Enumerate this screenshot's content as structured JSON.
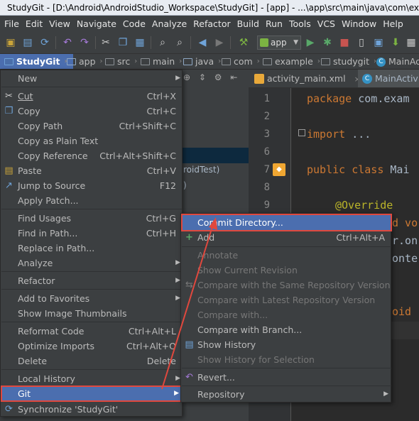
{
  "window": {
    "title": "StudyGit - [D:\\Android\\AndroidStudio_Workspace\\StudyGit] - [app] - ...\\app\\src\\main\\java\\com\\exa"
  },
  "menubar": [
    "File",
    "Edit",
    "View",
    "Navigate",
    "Code",
    "Analyze",
    "Refactor",
    "Build",
    "Run",
    "Tools",
    "VCS",
    "Window",
    "Help"
  ],
  "toolbar": {
    "run_config": "app"
  },
  "breadcrumbs": [
    "StudyGit",
    "app",
    "src",
    "main",
    "java",
    "com",
    "example",
    "studygit",
    "MainAc"
  ],
  "project_panel": {
    "tree_fragments": [
      "roidTest)",
      ")"
    ]
  },
  "tabs": [
    {
      "label": "activity_main.xml"
    },
    {
      "label": "MainActivity"
    }
  ],
  "editor": {
    "line_numbers": [
      "1",
      "2",
      "3",
      "6",
      "7",
      "8",
      "9"
    ],
    "code": {
      "l1_kw": "package",
      "l1_rest": " com.exam",
      "l3_kw": "import",
      "l3_rest": " ...",
      "l7_kw": "public class",
      "l7_rest": " Mai",
      "l9": "@Override",
      "p1": "d vo",
      "p2": "r.on",
      "p3": "onte",
      "p4": "oid"
    }
  },
  "context_menu": {
    "items": [
      {
        "label": "New",
        "shortcut": "",
        "submenu": true
      },
      {
        "label": "Cut",
        "shortcut": "Ctrl+X",
        "icon": "scissors-icon"
      },
      {
        "label": "Copy",
        "shortcut": "Ctrl+C",
        "icon": "copy-icon"
      },
      {
        "label": "Copy Path",
        "shortcut": "Ctrl+Shift+C"
      },
      {
        "label": "Copy as Plain Text",
        "shortcut": ""
      },
      {
        "label": "Copy Reference",
        "shortcut": "Ctrl+Alt+Shift+C"
      },
      {
        "label": "Paste",
        "shortcut": "Ctrl+V",
        "icon": "paste-icon"
      },
      {
        "label": "Jump to Source",
        "shortcut": "F12",
        "icon": "jump-icon"
      },
      {
        "label": "Apply Patch...",
        "shortcut": ""
      },
      {
        "label": "Find Usages",
        "shortcut": "Ctrl+G"
      },
      {
        "label": "Find in Path...",
        "shortcut": "Ctrl+H"
      },
      {
        "label": "Replace in Path...",
        "shortcut": ""
      },
      {
        "label": "Analyze",
        "shortcut": "",
        "submenu": true
      },
      {
        "label": "Refactor",
        "shortcut": "",
        "submenu": true
      },
      {
        "label": "Add to Favorites",
        "shortcut": "",
        "submenu": true
      },
      {
        "label": "Show Image Thumbnails",
        "shortcut": ""
      },
      {
        "label": "Reformat Code",
        "shortcut": "Ctrl+Alt+L"
      },
      {
        "label": "Optimize Imports",
        "shortcut": "Ctrl+Alt+O"
      },
      {
        "label": "Delete",
        "shortcut": "Delete"
      },
      {
        "label": "Local History",
        "shortcut": "",
        "submenu": true
      },
      {
        "label": "Git",
        "shortcut": "",
        "submenu": true
      },
      {
        "label": "Synchronize 'StudyGit'",
        "shortcut": "",
        "icon": "sync-icon"
      }
    ]
  },
  "git_submenu": {
    "items": [
      {
        "label": "Commit Directory...",
        "shortcut": ""
      },
      {
        "label": "Add",
        "shortcut": "Ctrl+Alt+A",
        "icon": "plus-icon"
      },
      {
        "label": "Annotate",
        "shortcut": "",
        "disabled": true
      },
      {
        "label": "Show Current Revision",
        "shortcut": "",
        "disabled": true
      },
      {
        "label": "Compare with the Same Repository Version",
        "shortcut": "",
        "disabled": true
      },
      {
        "label": "Compare with Latest Repository Version",
        "shortcut": "",
        "disabled": true
      },
      {
        "label": "Compare with...",
        "shortcut": "",
        "disabled": true
      },
      {
        "label": "Compare with Branch...",
        "shortcut": ""
      },
      {
        "label": "Show History",
        "shortcut": "",
        "icon": "history-icon"
      },
      {
        "label": "Show History for Selection",
        "shortcut": "",
        "disabled": true
      },
      {
        "label": "Revert...",
        "shortcut": "",
        "icon": "revert-icon"
      },
      {
        "label": "Repository",
        "shortcut": "",
        "submenu": true
      }
    ]
  },
  "colors": {
    "highlight": "#4b6eaf",
    "annotation_red": "#e0483e"
  }
}
